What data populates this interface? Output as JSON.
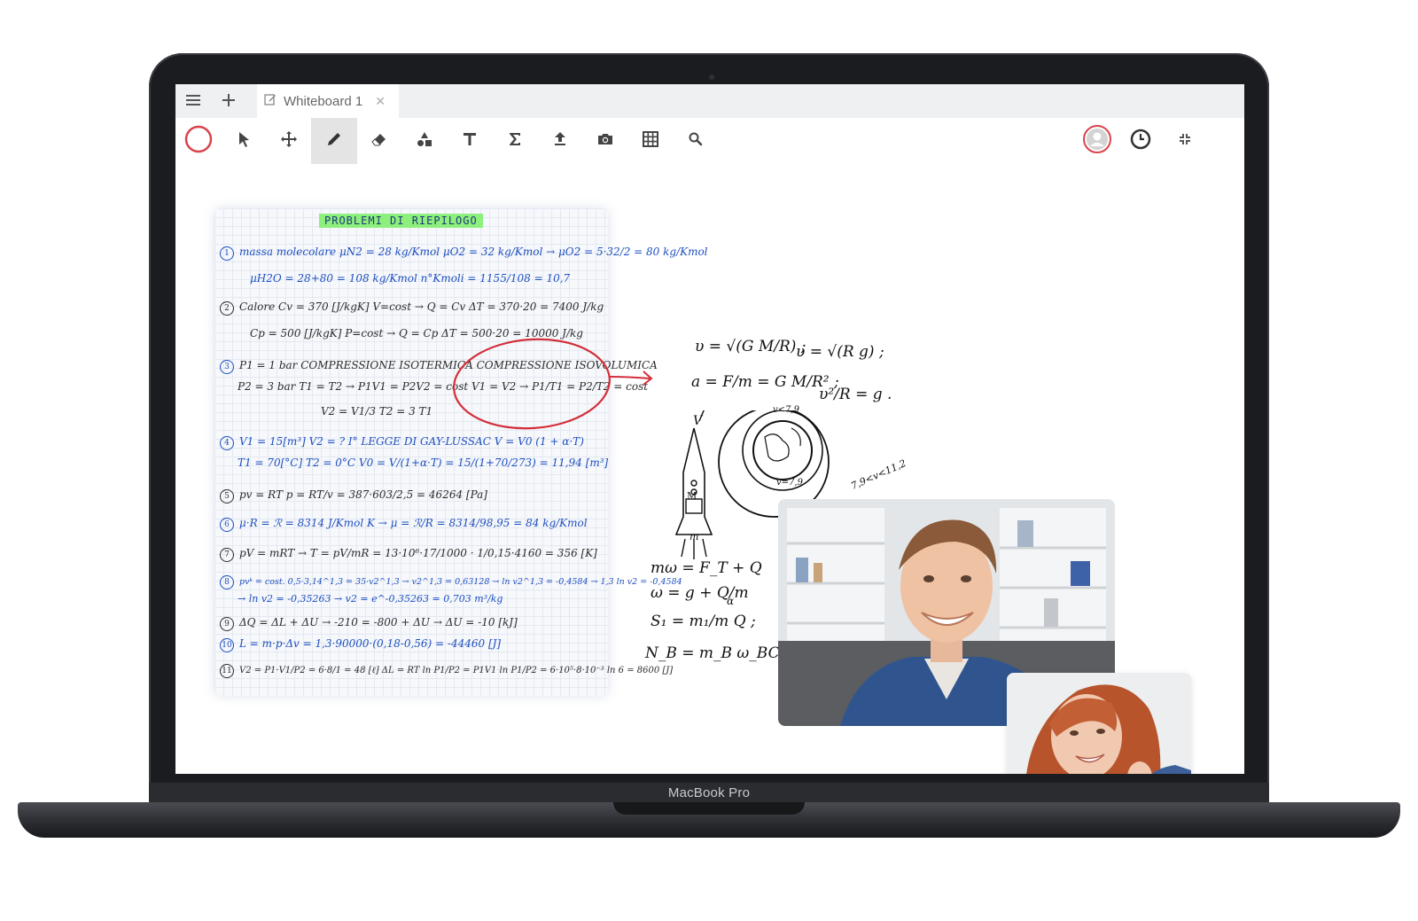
{
  "device": {
    "brand_label": "MacBook Pro"
  },
  "tabbar": {
    "tab_title": "Whiteboard 1"
  },
  "toolbar": {
    "tools": [
      "record",
      "select",
      "move",
      "pen",
      "eraser",
      "shapes",
      "text",
      "formula",
      "upload",
      "camera",
      "table",
      "search"
    ],
    "active_tool": "pen",
    "right_tools": [
      "user-avatar",
      "timer",
      "collapse"
    ]
  },
  "notes": {
    "title": "PROBLEMI DI RIEPILOGO",
    "lines": [
      {
        "num": "1",
        "text": "massa molecolare  μN2 = 28 kg/Kmol   μO2 = 32 kg/Kmol → μO2 = 5·32/2 = 80 kg/Kmol"
      },
      {
        "num": "",
        "text": "μH2O = 28+80 = 108 kg/Kmol   n°Kmoli = 1155/108 = 10,7"
      },
      {
        "num": "2",
        "text": "Calore  Cv = 370 [J/kgK]   V=cost → Q = Cv ΔT = 370·20 = 7400 J/kg"
      },
      {
        "num": "",
        "text": "Cp = 500 [J/kgK]   P=cost → Q = Cp ΔT = 500·20 = 10000 J/kg"
      },
      {
        "num": "3",
        "text": "P1 = 1 bar   COMPRESSIONE ISOTERMICA   COMPRESSIONE ISOVOLUMICA"
      },
      {
        "num": "",
        "text": "P2 = 3 bar   T1 = T2 → P1V1 = P2V2 = cost   V1 = V2 → P1/T1 = P2/T2 = cost"
      },
      {
        "num": "",
        "text": "V2 = V1/3   T2 = 3 T1"
      },
      {
        "num": "4",
        "text": "V1 = 15[m³]  V2 = ?  I° LEGGE DI GAY-LUSSAC  V = V0 (1 + α·T)"
      },
      {
        "num": "",
        "text": "T1 = 70[°C]  T2 = 0°C   V0 = V/(1+α·T) = 15/(1+70/273) = 11,94 [m³]"
      },
      {
        "num": "5",
        "text": "pv = RT   p = RT/v = 387·603/2,5 = 46264 [Pa]"
      },
      {
        "num": "6",
        "text": "μ·R = ℛ = 8314 J/Kmol K → μ = ℛ/R = 8314/98,95 = 84 kg/Kmol"
      },
      {
        "num": "7",
        "text": "pV = mRT → T = pV/mR = 13·10⁶·17/1000 · 1/0,15·4160 = 356 [K]"
      },
      {
        "num": "8",
        "text": "pvᵏ = cost.  0,5·3,14^1,3 = 35·v2^1,3 → v2^1,3 = 0,63128 → ln v2^1,3 = -0,4584 → 1,3 ln v2 = -0,4584"
      },
      {
        "num": "",
        "text": "→ ln v2 = -0,35263 → v2 = e^-0,35263 = 0,703 m³/kg"
      },
      {
        "num": "9",
        "text": "ΔQ = ΔL + ΔU → -210 = -800 + ΔU → ΔU = -10 [kJ]"
      },
      {
        "num": "10",
        "text": "L = m·p·Δv = 1,3·90000·(0,18-0,56) = -44460 [J]"
      },
      {
        "num": "11",
        "text": "V2 = P1·V1/P2 = 6·8/1 = 48 [ℓ]   ΔL = RT ln P1/P2 = P1V1 ln P1/P2 = 6·10⁵·8·10⁻³ ln 6 = 8600 [J]"
      }
    ]
  },
  "sketch": {
    "formulas": [
      "υ = √(G M/R) ;",
      "υ = √(R g) ;",
      "a = F/m = G M/R² ;",
      "υ²/R = g .",
      "mω = F_T + Q",
      "ω = g + Q/m",
      "S₁ = m₁/m Q ;",
      "N_B = m_B ω_BC ;"
    ],
    "labels": [
      "V",
      "M",
      "m",
      "v<7,9",
      "v=7,9",
      "7,9<v<11,2",
      "α"
    ]
  },
  "video": {
    "participants": [
      "participant-man",
      "participant-woman"
    ]
  },
  "colors": {
    "record_ring": "#d9434a",
    "annotation_red": "#d32f3a",
    "ink_blue": "#1e4fc0",
    "highlighter_green": "#8ef07c"
  }
}
